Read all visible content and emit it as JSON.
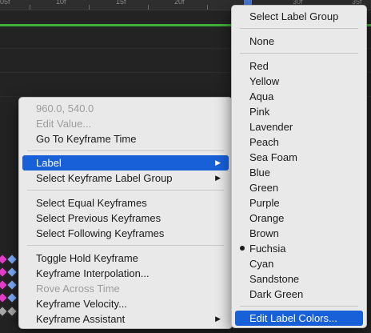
{
  "ruler": {
    "ticks": [
      "05f",
      "10f",
      "15f",
      "20f",
      "30f",
      "35f"
    ]
  },
  "context_menu": {
    "items": [
      {
        "label": "960.0, 540.0",
        "enabled": false
      },
      {
        "label": "Edit Value...",
        "enabled": false
      },
      {
        "label": "Go To Keyframe Time",
        "enabled": true
      },
      {
        "label": "Label",
        "enabled": true,
        "highlighted": true,
        "submenu": true
      },
      {
        "label": "Select Keyframe Label Group",
        "enabled": true,
        "submenu": true
      },
      {
        "label": "Select Equal Keyframes",
        "enabled": true
      },
      {
        "label": "Select Previous Keyframes",
        "enabled": true
      },
      {
        "label": "Select Following Keyframes",
        "enabled": true
      },
      {
        "label": "Toggle Hold Keyframe",
        "enabled": true
      },
      {
        "label": "Keyframe Interpolation...",
        "enabled": true
      },
      {
        "label": "Rove Across Time",
        "enabled": false
      },
      {
        "label": "Keyframe Velocity...",
        "enabled": true
      },
      {
        "label": "Keyframe Assistant",
        "enabled": true,
        "submenu": true
      }
    ],
    "submenu_arrow": "▶"
  },
  "label_submenu": {
    "select_group": "Select Label Group",
    "none": "None",
    "colors": [
      "Red",
      "Yellow",
      "Aqua",
      "Pink",
      "Lavender",
      "Peach",
      "Sea Foam",
      "Blue",
      "Green",
      "Purple",
      "Orange",
      "Brown",
      "Fuchsia",
      "Cyan",
      "Sandstone",
      "Dark Green"
    ],
    "checked": "Fuchsia",
    "edit_colors": "Edit Label Colors..."
  },
  "theme": {
    "highlight": "#1760d8",
    "work_area": "#3fae3a",
    "menu_bg": "#e9e9e9",
    "keyframe_selected": "#e040c8"
  }
}
